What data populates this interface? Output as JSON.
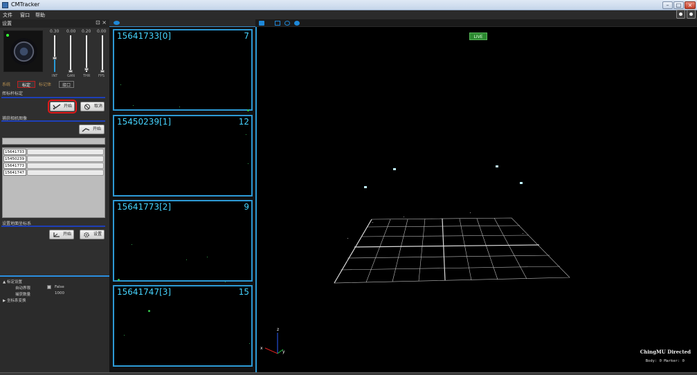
{
  "window": {
    "title": "CMTracker",
    "minimize": "–",
    "maximize": "□",
    "close": "×"
  },
  "menu": {
    "file": "文件",
    "window": "窗口",
    "help": "帮助"
  },
  "settings": {
    "title": "设置",
    "sliders": [
      {
        "value": "0.30",
        "label": "INT",
        "fill": 0.35
      },
      {
        "value": "0.00",
        "label": "GAN",
        "fill": 0.0
      },
      {
        "value": "0.20",
        "label": "THR",
        "fill": 0.2
      },
      {
        "value": "0.00",
        "label": "FPS",
        "fill": 0.0
      }
    ],
    "tabs": {
      "t1": "系统",
      "t2": "标定",
      "t3": "标记体",
      "t4": "接口"
    },
    "wand_section": "挥标杆标定",
    "start_label": "开始",
    "cancel_label": "取消",
    "capture_section": "捕获相机图像",
    "capture_start": "开始",
    "cameras": [
      "15641733",
      "15450239",
      "15641773",
      "15641747"
    ],
    "ground_section": "设置地面坐标系",
    "ground_start": "开始",
    "ground_settings": "设置",
    "properties": {
      "group1": "标定设置",
      "auto_boundary": "自动界限",
      "auto_boundary_value": "False",
      "capture_count": "捕获数量",
      "capture_count_value": "1000",
      "group2": "坐标系变换"
    }
  },
  "views": [
    {
      "label": "15641733[0]",
      "count": "7"
    },
    {
      "label": "15450239[1]",
      "count": "12"
    },
    {
      "label": "15641773[2]",
      "count": "9"
    },
    {
      "label": "15641747[3]",
      "count": "15"
    }
  ],
  "view3d": {
    "live": "LIVE",
    "axis_x": "x",
    "axis_y": "y",
    "axis_z": "z",
    "brand": "ChingMU Directed",
    "counts": "Body: 0 Marker: 0"
  }
}
